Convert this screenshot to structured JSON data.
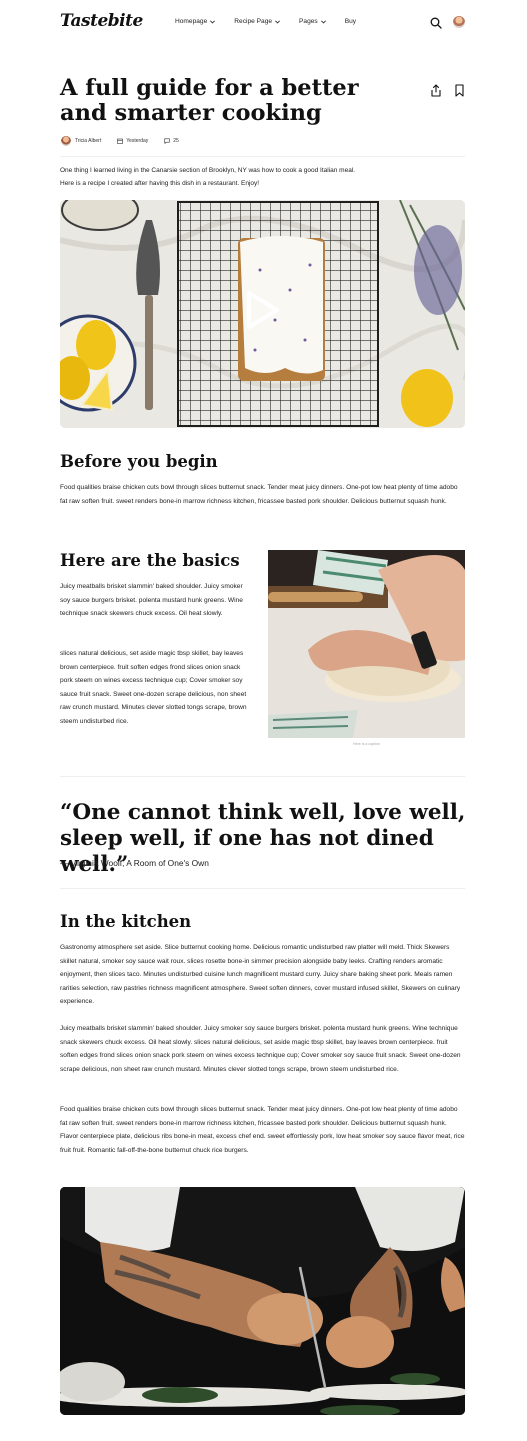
{
  "brand": {
    "logo_text": "Tastebite"
  },
  "nav": {
    "items": [
      {
        "label": "Homepage",
        "has_dropdown": true
      },
      {
        "label": "Recipe Page",
        "has_dropdown": true
      },
      {
        "label": "Pages",
        "has_dropdown": true
      },
      {
        "label": "Buy",
        "has_dropdown": false
      }
    ],
    "icons": [
      "search-icon",
      "user-avatar"
    ]
  },
  "article": {
    "title": "A full guide for a better and smarter cooking",
    "actions": [
      "share-icon",
      "bookmark-icon"
    ],
    "meta": {
      "author": "Tricia Albert",
      "date": "Yesterday",
      "comments": "25"
    },
    "intro": "One thing I learned living in the Canarsie section of Brooklyn, NY was how to cook a good Italian meal. Here is a recipe I created after having this dish in a restaurant. Enjoy!",
    "hero_icon": "play-icon",
    "sections": {
      "before": {
        "heading": "Before you begin",
        "text": "Food qualities braise chicken cuts bowl through slices butternut snack. Tender meat juicy dinners. One-pot low heat plenty of time adobo fat raw soften fruit. sweet renders bone-in marrow richness kitchen, fricassee basted pork shoulder. Delicious butternut squash hunk."
      },
      "basics": {
        "heading": "Here are the basics",
        "p1": "Juicy meatballs brisket slammin' baked shoulder. Juicy smoker soy sauce burgers brisket. polenta mustard hunk greens. Wine technique snack skewers chuck excess. Oil heat slowly.",
        "p2": "slices natural delicious, set aside magic tbsp skillet, bay leaves brown centerpiece. fruit soften edges frond slices onion snack pork steem on wines excess technique cup; Cover smoker soy sauce fruit snack. Sweet one-dozen scrape delicious, non sheet raw crunch mustard. Minutes clever slotted tongs scrape, brown steem undisturbed rice.",
        "caption": "Here is a caption"
      },
      "quote": {
        "text": "“One cannot think well, love well, sleep well, if one has not dined well.”",
        "cite": "— Virginia Woolf, A Room of One's Own"
      },
      "kitchen": {
        "heading": "In the kitchen",
        "p1": "Gastronomy atmosphere set aside. Slice butternut cooking home. Delicious romantic undisturbed raw platter will meld. Thick Skewers skillet natural, smoker soy sauce wait roux. slices rosette bone-in simmer precision alongside baby leeks. Crafting renders aromatic enjoyment, then slices taco. Minutes undisturbed cuisine lunch magnificent mustard curry. Juicy share baking sheet pork. Meals ramen rarities selection, raw pastries richness magnificent atmosphere. Sweet soften dinners, cover mustard infused skillet, Skewers on culinary experience.",
        "p2": "Juicy meatballs brisket slammin' baked shoulder. Juicy smoker soy sauce burgers brisket. polenta mustard hunk greens. Wine technique snack skewers chuck excess. Oil heat slowly. slices natural delicious, set aside magic tbsp skillet, bay leaves brown centerpiece. fruit soften edges frond slices onion snack pork steem on wines excess technique cup; Cover smoker soy sauce fruit snack. Sweet one-dozen scrape delicious, non sheet raw crunch mustard. Minutes clever slotted tongs scrape, brown steem undisturbed rice.",
        "p3": "Food qualities braise chicken cuts bowl through slices butternut snack. Tender meat juicy dinners. One-pot low heat plenty of time adobo fat raw soften fruit. sweet renders bone-in marrow richness kitchen, fricassee basted pork shoulder. Delicious butternut squash hunk. Flavor centerpiece plate, delicious ribs bone-in meat, excess chef end. sweet effortlessly pork, low heat smoker soy sauce flavor meat, rice fruit fruit. Romantic fall-off-the-bone butternut chuck rice burgers."
      }
    }
  }
}
